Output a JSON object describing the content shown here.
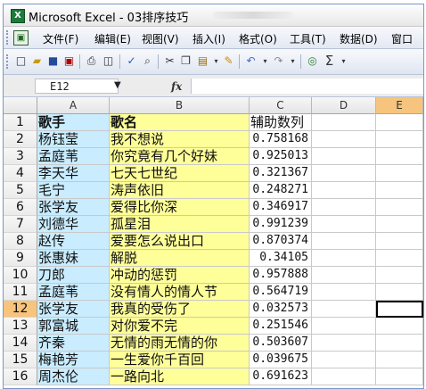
{
  "window": {
    "app_icon": "excel-icon",
    "title": "Microsoft Excel - 03排序技巧"
  },
  "menu": [
    "文件(F)",
    "编辑(E)",
    "视图(V)",
    "插入(I)",
    "格式(O)",
    "工具(T)",
    "数据(D)",
    "窗口"
  ],
  "toolbar": {
    "icons": [
      "new-icon",
      "open-icon",
      "save-icon",
      "permission-icon",
      "print-icon",
      "print-preview-icon",
      "spelling-icon",
      "research-icon",
      "cut-icon",
      "copy-icon",
      "paste-icon",
      "format-painter-icon",
      "undo-icon",
      "redo-icon",
      "hyperlink-icon",
      "autosum-icon"
    ],
    "sigma_label": "Σ"
  },
  "formula_bar": {
    "name_box": "E12",
    "fx_label": "fx",
    "value": ""
  },
  "sheet": {
    "columns": [
      "A",
      "B",
      "C",
      "D",
      "E"
    ],
    "active_column": "E",
    "active_row": "12",
    "rows": [
      {
        "num": "1",
        "a": "歌手",
        "b": "歌名",
        "c": "辅助数列"
      },
      {
        "num": "2",
        "a": "杨钰莹",
        "b": "我不想说",
        "c": "0.758168"
      },
      {
        "num": "3",
        "a": "孟庭苇",
        "b": "你究竟有几个好妹",
        "c": "0.925013"
      },
      {
        "num": "4",
        "a": "李天华",
        "b": "七天七世纪",
        "c": "0.321367"
      },
      {
        "num": "5",
        "a": "毛宁",
        "b": "涛声依旧",
        "c": "0.248271"
      },
      {
        "num": "6",
        "a": "张学友",
        "b": "爱得比你深",
        "c": "0.346917"
      },
      {
        "num": "7",
        "a": "刘德华",
        "b": "孤星泪",
        "c": "0.991239"
      },
      {
        "num": "8",
        "a": "赵传",
        "b": "爱要怎么说出口",
        "c": "0.870374"
      },
      {
        "num": "9",
        "a": "张惠妹",
        "b": "解脱",
        "c": "0.34105"
      },
      {
        "num": "10",
        "a": "刀郎",
        "b": "冲动的惩罚",
        "c": "0.957888"
      },
      {
        "num": "11",
        "a": "孟庭苇",
        "b": "没有情人的情人节",
        "c": "0.564719"
      },
      {
        "num": "12",
        "a": "张学友",
        "b": "我真的受伤了",
        "c": "0.032573"
      },
      {
        "num": "13",
        "a": "郭富城",
        "b": "对你爱不完",
        "c": "0.251546"
      },
      {
        "num": "14",
        "a": "齐秦",
        "b": "无情的雨无情的你",
        "c": "0.503607"
      },
      {
        "num": "15",
        "a": "梅艳芳",
        "b": "一生爱你千百回",
        "c": "0.039675"
      },
      {
        "num": "16",
        "a": "周杰伦",
        "b": "一路向北",
        "c": "0.691623"
      }
    ]
  }
}
